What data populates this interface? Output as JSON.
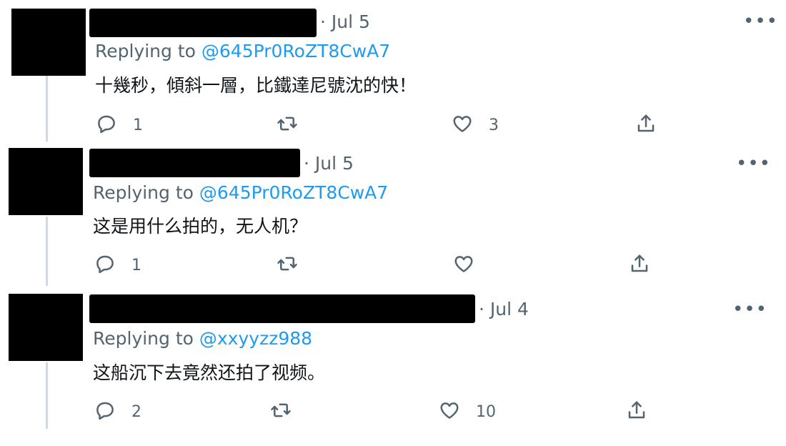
{
  "replying_prefix": "Replying to ",
  "tweets": [
    {
      "date": "· Jul 5",
      "more": "•••",
      "handle": "@645Pr0RoZT8CwA7",
      "text": "十幾秒，傾斜一層，比鐵達尼號沈的快！",
      "reply_count": "1",
      "retweet_count": "",
      "like_count": "3"
    },
    {
      "date": "· Jul 5",
      "more": "•••",
      "handle": "@645Pr0RoZT8CwA7",
      "text": "这是用什么拍的，无人机？",
      "reply_count": "1",
      "retweet_count": "",
      "like_count": ""
    },
    {
      "date": "· Jul 4",
      "more": "•••",
      "handle": "@xxyyzz988",
      "text": "这船沉下去竟然还拍了视频。",
      "reply_count": "2",
      "retweet_count": "",
      "like_count": "10"
    }
  ],
  "icons": {
    "reply": "reply-icon",
    "retweet": "retweet-icon",
    "like": "heart-icon",
    "share": "share-icon"
  },
  "colors": {
    "link": "#1d9bf0",
    "secondary_text": "#536471",
    "redaction": "#000000"
  }
}
